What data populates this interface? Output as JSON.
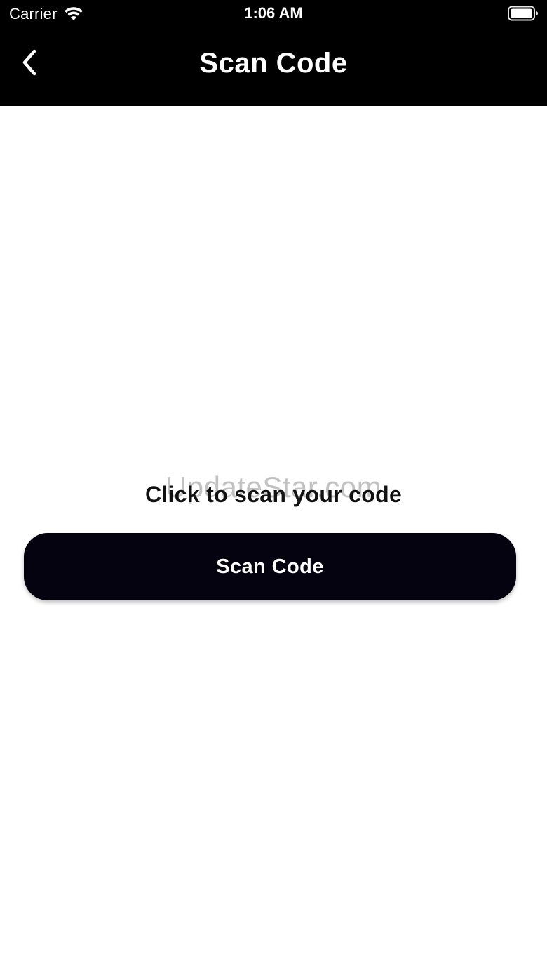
{
  "status_bar": {
    "carrier": "Carrier",
    "time": "1:06 AM",
    "wifi_icon": "wifi-icon",
    "battery_icon": "battery-full-icon"
  },
  "nav": {
    "title": "Scan Code",
    "back_icon": "chevron-left-icon"
  },
  "main": {
    "prompt": "Click to scan your code",
    "scan_button_label": "Scan Code",
    "watermark": "UpdateStar.com"
  },
  "colors": {
    "header_bg": "#000000",
    "button_bg": "#05030f",
    "page_bg": "#ffffff",
    "text_primary": "#111111"
  }
}
